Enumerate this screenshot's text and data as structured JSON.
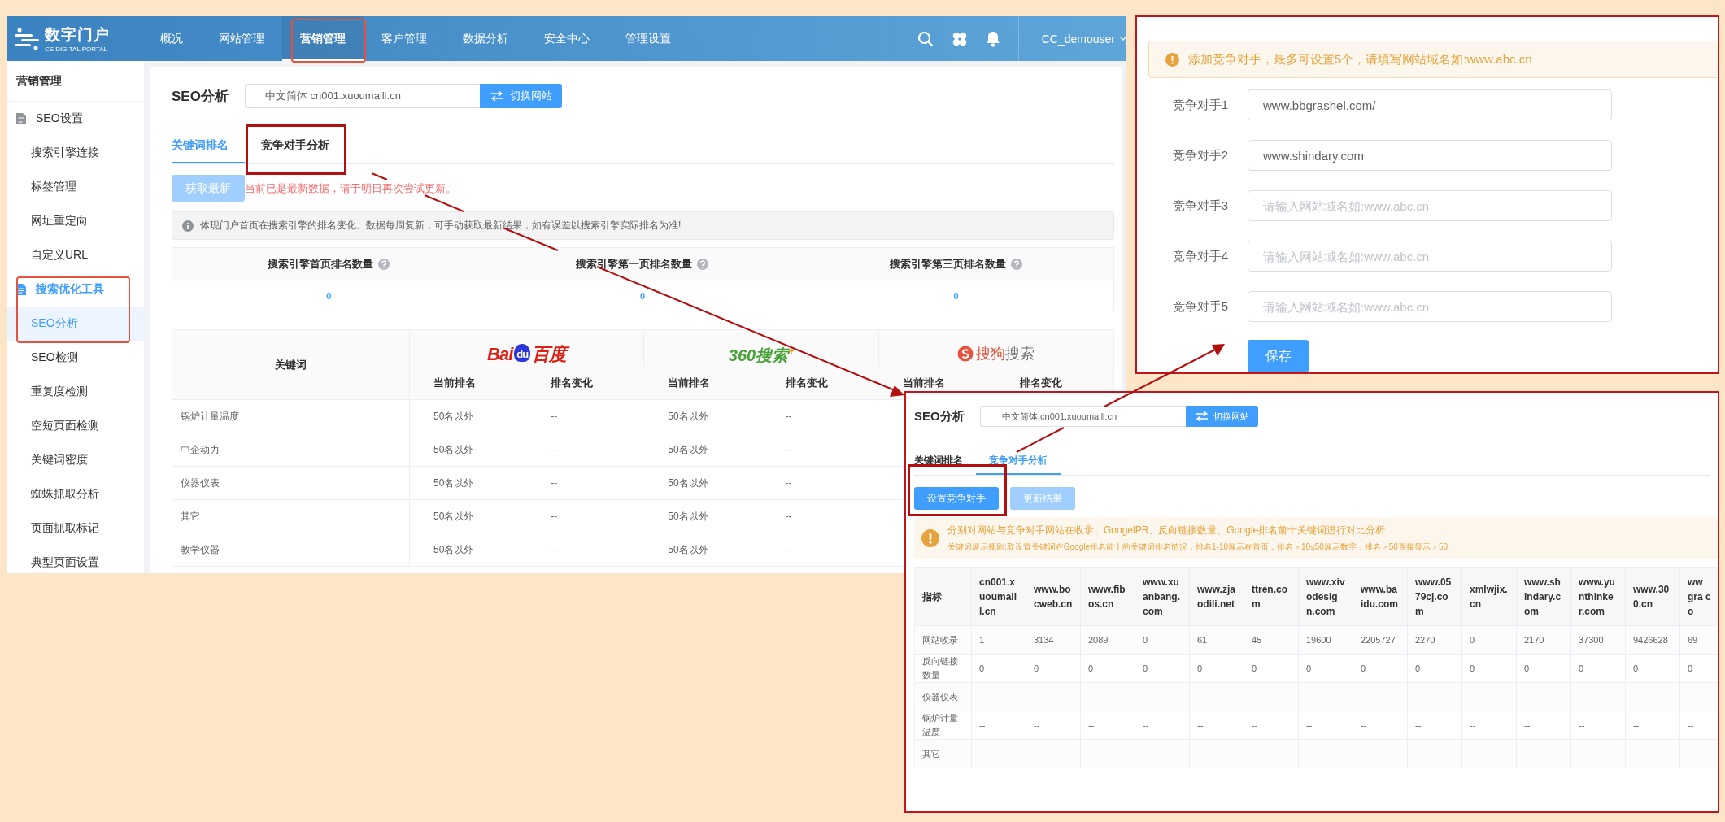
{
  "main_app": {
    "logo": {
      "name": "数字门户",
      "subtitle": "CE DIGITAL PORTAL"
    },
    "nav": [
      {
        "label": "概况",
        "selected": false
      },
      {
        "label": "网站管理",
        "selected": false
      },
      {
        "label": "营销管理",
        "selected": true
      },
      {
        "label": "客户管理",
        "selected": false
      },
      {
        "label": "数据分析",
        "selected": false
      },
      {
        "label": "安全中心",
        "selected": false
      },
      {
        "label": "管理设置",
        "selected": false
      }
    ],
    "user": "CC_demouser",
    "sidebar": {
      "title": "营销管理",
      "groups": [
        {
          "label": "SEO设置",
          "selected": false,
          "children": [
            {
              "label": "搜索引擎连接",
              "selected": false
            },
            {
              "label": "标签管理",
              "selected": false
            },
            {
              "label": "网址重定向",
              "selected": false
            },
            {
              "label": "自定义URL",
              "selected": false
            }
          ]
        },
        {
          "label": "搜索优化工具",
          "selected": true,
          "children": [
            {
              "label": "SEO分析",
              "selected": true
            },
            {
              "label": "SEO检测",
              "selected": false
            },
            {
              "label": "重复度检测",
              "selected": false
            },
            {
              "label": "空短页面检测",
              "selected": false
            },
            {
              "label": "关键词密度",
              "selected": false
            },
            {
              "label": "蜘蛛抓取分析",
              "selected": false
            },
            {
              "label": "页面抓取标记",
              "selected": false
            },
            {
              "label": "典型页面设置",
              "selected": false
            }
          ]
        }
      ]
    },
    "page_title": "SEO分析",
    "site_field": "中文简体 cn001.xuoumaill.cn",
    "switch_button": "切换网站",
    "tabs": [
      {
        "label": "关键词排名",
        "selected": true
      },
      {
        "label": "竞争对手分析",
        "selected": false
      }
    ],
    "refresh_button": {
      "label": "获取最新",
      "disabled": true
    },
    "notice": "当前已是最新数据，请于明日再次尝试更新。",
    "info": "体现门户首页在搜索引擎的排名变化。数据每周复新，可手动获取最新结果，如有误差以搜索引擎实际排名为准!",
    "stats": [
      {
        "label": "搜索引擎首页排名数量",
        "value": "0"
      },
      {
        "label": "搜索引擎第一页排名数量",
        "value": "0"
      },
      {
        "label": "搜索引擎第三页排名数量",
        "value": "0"
      }
    ],
    "ranking_table": {
      "keyword_header": "关键词",
      "engines": [
        {
          "kind": "baidu",
          "logo": [
            "Bai",
            "du",
            "百度"
          ],
          "columns": [
            "当前排名",
            "排名变化"
          ]
        },
        {
          "kind": "so",
          "logo": [
            "360搜索",
            "+"
          ],
          "columns": [
            "当前排名",
            "排名变化"
          ]
        },
        {
          "kind": "sogou",
          "logo": [
            "搜狗",
            "搜索"
          ],
          "columns": [
            "当前排名",
            "排名变化"
          ]
        }
      ],
      "rows": [
        {
          "keyword": "锅炉计量温度",
          "cells": [
            "50名以外",
            "--",
            "50名以外",
            "--"
          ]
        },
        {
          "keyword": "中企动力",
          "cells": [
            "50名以外",
            "--",
            "50名以外",
            "--"
          ]
        },
        {
          "keyword": "仪器仪表",
          "cells": [
            "50名以外",
            "--",
            "50名以外",
            "--"
          ]
        },
        {
          "keyword": "其它",
          "cells": [
            "50名以外",
            "--",
            "50名以外",
            "--"
          ]
        },
        {
          "keyword": "教学仪器",
          "cells": [
            "50名以外",
            "--",
            "50名以外",
            "--"
          ]
        }
      ]
    }
  },
  "competitor_form": {
    "alert": "添加竞争对手，最多可设置5个，请填写网站域名如:www.abc.cn",
    "fields": [
      {
        "label": "竞争对手1",
        "value": "www.bbgrashel.com/"
      },
      {
        "label": "竞争对手2",
        "value": "www.shindary.com"
      },
      {
        "label": "竞争对手3",
        "placeholder": "请输入网站域名如:www.abc.cn"
      },
      {
        "label": "竞争对手4",
        "placeholder": "请输入网站域名如:www.abc.cn"
      },
      {
        "label": "竞争对手5",
        "placeholder": "请输入网站域名如:www.abc.cn"
      }
    ],
    "save_button": "保存"
  },
  "competitor_view": {
    "page_title": "SEO分析",
    "site_field": "中文简体 cn001.xuoumaill.cn",
    "switch_button": "切换网站",
    "tabs": [
      {
        "label": "关键词排名",
        "selected": false
      },
      {
        "label": "竞争对手分析",
        "selected": true
      }
    ],
    "buttons": [
      {
        "label": "设置竞争对手",
        "disabled": false
      },
      {
        "label": "更新结果",
        "disabled": true
      }
    ],
    "alert": [
      "分别对网站与竞争对手网站在收录、GoogelPR、反向链接数量、Google排名前十关键词进行对比分析",
      "关键词展示规则:取设置关键词在Google排名前十的关键词排名情况，排名1-10展示在首页，排名＞10≤50展示数字，排名＞50直接显示＞50"
    ],
    "table": {
      "columns": [
        "指标",
        "cn001.xuoumaill.cn",
        "www.bocweb.cn",
        "www.fibos.cn",
        "www.xuanbang.com",
        "www.zjaodili.net",
        "ttren.com",
        "www.xivodesign.com",
        "www.baidu.com",
        "www.0579cj.com",
        "xmlwjix.cn",
        "www.shindary.com",
        "www.yunthinker.com",
        "www.300.cn",
        "ww gra co"
      ],
      "rows": [
        {
          "cells": [
            "网站收录",
            "1",
            "3134",
            "2089",
            "0",
            "61",
            "45",
            "19600",
            "2205727",
            "2270",
            "0",
            "2170",
            "37300",
            "9426628",
            "69"
          ]
        },
        {
          "cells": [
            "反向链接数量",
            "0",
            "0",
            "0",
            "0",
            "0",
            "0",
            "0",
            "0",
            "0",
            "0",
            "0",
            "0",
            "0",
            "0"
          ]
        },
        {
          "cells": [
            "仪器仪表",
            "--",
            "--",
            "--",
            "--",
            "--",
            "--",
            "--",
            "--",
            "--",
            "--",
            "--",
            "--",
            "--",
            "--"
          ]
        },
        {
          "cells": [
            "锅炉计量温度",
            "--",
            "--",
            "--",
            "--",
            "--",
            "--",
            "--",
            "--",
            "--",
            "--",
            "--",
            "--",
            "--",
            "--"
          ]
        },
        {
          "cells": [
            "其它",
            "--",
            "--",
            "--",
            "--",
            "--",
            "--",
            "--",
            "--",
            "--",
            "--",
            "--",
            "--",
            "--",
            "--"
          ]
        }
      ]
    }
  }
}
